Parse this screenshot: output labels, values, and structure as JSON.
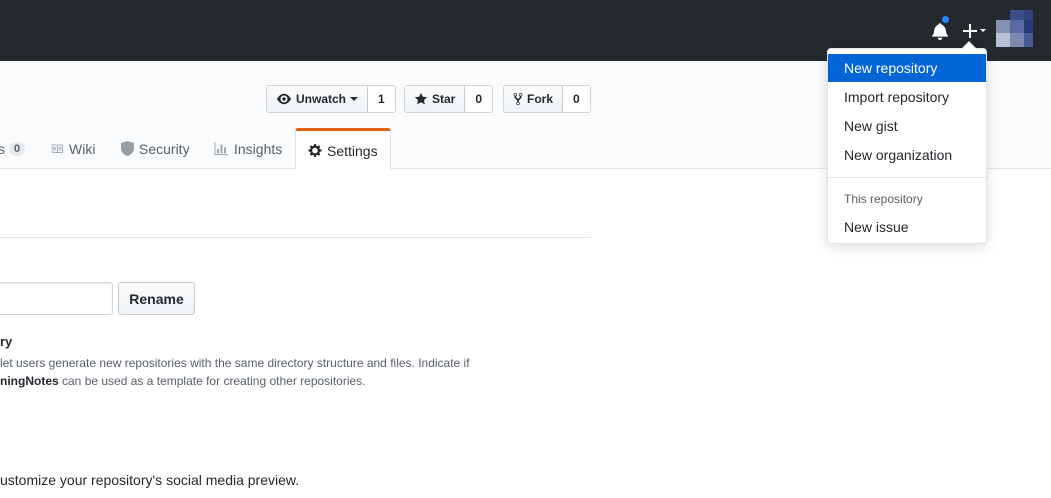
{
  "header": {
    "icons": [
      "bell-icon",
      "plus-icon",
      "avatar"
    ],
    "notification_dot_color": "#2188ff",
    "background_color": "#24292e"
  },
  "repo_actions": {
    "watch": {
      "label": "Unwatch",
      "count": "1"
    },
    "star": {
      "label": "Star",
      "count": "0"
    },
    "fork": {
      "label": "Fork",
      "count": "0"
    }
  },
  "tabs": [
    {
      "label": "s",
      "counter": "0"
    },
    {
      "label": "Wiki"
    },
    {
      "label": "Security"
    },
    {
      "label": "Insights"
    },
    {
      "label": "Settings",
      "selected": true
    }
  ],
  "settings": {
    "rename_label": "Rename",
    "repo_name_value": "",
    "template_title": "ry",
    "template_desc_line1": "let users generate new repositories with the same directory structure and files. Indicate if",
    "template_desc_bold": "ningNotes",
    "template_desc_line2": " can be used as a template for creating other repositories.",
    "social_preview_text": "ustomize your repository's social media preview."
  },
  "dropdown": {
    "items": [
      "New repository",
      "Import repository",
      "New gist",
      "New organization"
    ],
    "section_header": "This repository",
    "section_items": [
      "New issue"
    ],
    "active_color": "#0366d6"
  },
  "accent_colors": {
    "selected_tab_border": "#e36209"
  }
}
